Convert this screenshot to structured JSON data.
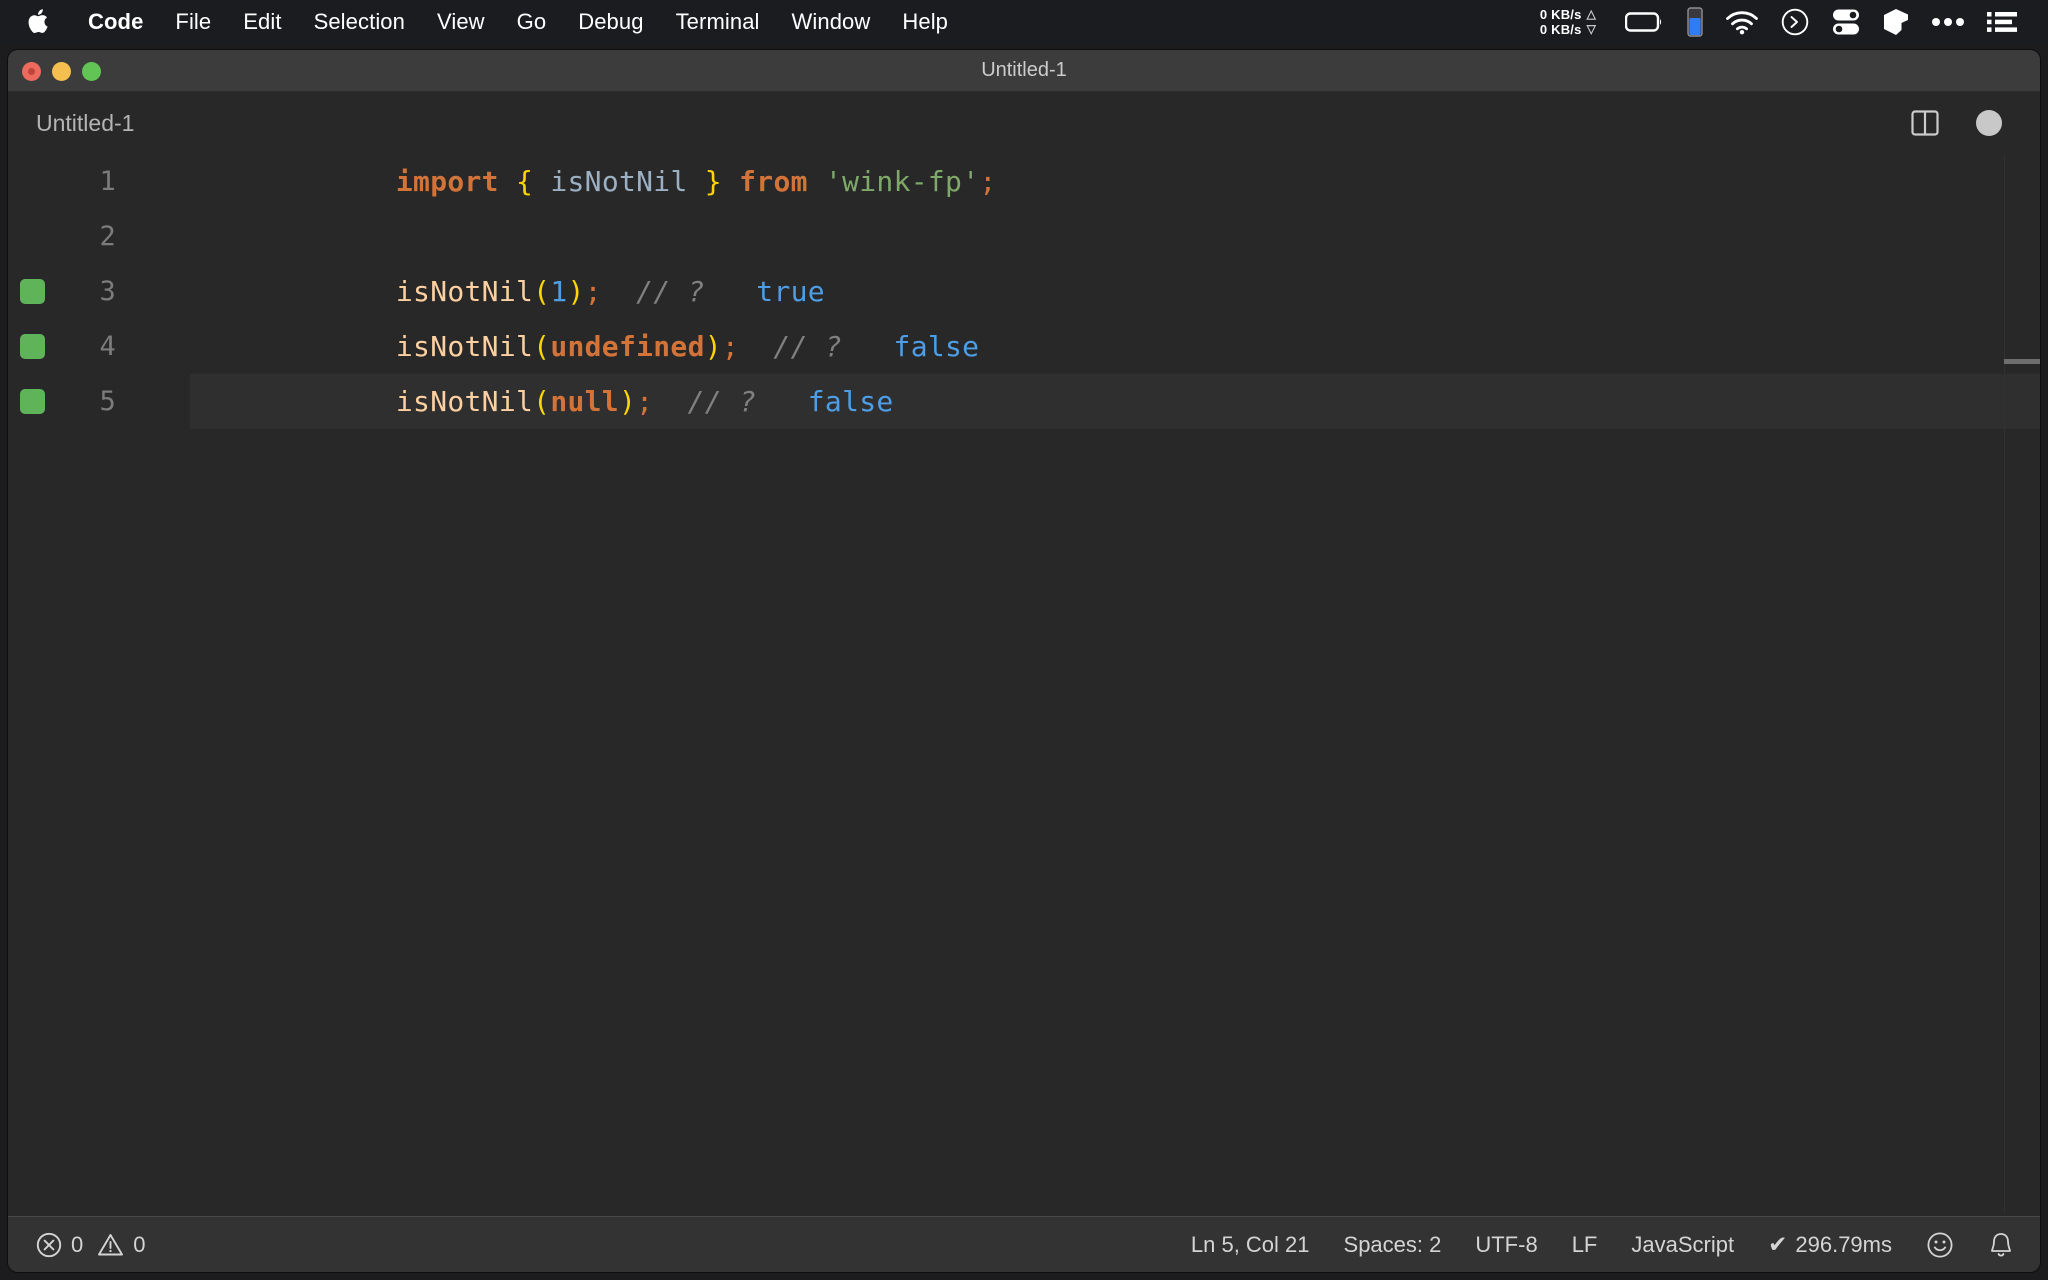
{
  "menubar": {
    "apple_icon": "apple-logo-icon",
    "items": [
      {
        "label": "Code",
        "bold": true
      },
      {
        "label": "File",
        "bold": false
      },
      {
        "label": "Edit",
        "bold": false
      },
      {
        "label": "Selection",
        "bold": false
      },
      {
        "label": "View",
        "bold": false
      },
      {
        "label": "Go",
        "bold": false
      },
      {
        "label": "Debug",
        "bold": false
      },
      {
        "label": "Terminal",
        "bold": false
      },
      {
        "label": "Window",
        "bold": false
      },
      {
        "label": "Help",
        "bold": false
      }
    ],
    "network": {
      "upload": "0 KB/s",
      "download": "0 KB/s",
      "up_arrow": "△",
      "down_arrow": "▽"
    },
    "status_icons": [
      "battery-icon",
      "device-battery-blue-icon",
      "wifi-icon",
      "terminal-prompt-icon",
      "control-center-icon",
      "docker-box-icon",
      "ellipsis-icon",
      "menu-list-icon"
    ]
  },
  "window": {
    "title": "Untitled-1",
    "traffic_lights": [
      "close-button",
      "minimize-button",
      "zoom-button"
    ]
  },
  "editor": {
    "tab": {
      "label": "Untitled-1"
    },
    "actions": [
      "split-editor-icon",
      "unsaved-dot-indicator"
    ],
    "lines": [
      {
        "number": "1",
        "marker": false,
        "active": false,
        "tokens": [
          {
            "text": "import",
            "cls": "t-kw"
          },
          {
            "text": " ",
            "cls": "t-plain"
          },
          {
            "text": "{",
            "cls": "t-brc"
          },
          {
            "text": " ",
            "cls": "t-plain"
          },
          {
            "text": "isNotNil",
            "cls": "t-ident"
          },
          {
            "text": " ",
            "cls": "t-plain"
          },
          {
            "text": "}",
            "cls": "t-brc"
          },
          {
            "text": " ",
            "cls": "t-plain"
          },
          {
            "text": "from",
            "cls": "t-kw"
          },
          {
            "text": " ",
            "cls": "t-plain"
          },
          {
            "text": "'wink-fp'",
            "cls": "t-str"
          },
          {
            "text": ";",
            "cls": "t-punc"
          }
        ]
      },
      {
        "number": "2",
        "marker": false,
        "active": false,
        "tokens": []
      },
      {
        "number": "3",
        "marker": true,
        "active": false,
        "tokens": [
          {
            "text": "isNotNil",
            "cls": "t-fn"
          },
          {
            "text": "(",
            "cls": "t-brc"
          },
          {
            "text": "1",
            "cls": "t-num"
          },
          {
            "text": ")",
            "cls": "t-brc"
          },
          {
            "text": ";",
            "cls": "t-punc"
          },
          {
            "text": " ",
            "cls": "t-plain"
          },
          {
            "text": "// ?",
            "cls": "t-com"
          },
          {
            "text": "  ",
            "cls": "t-plain"
          },
          {
            "text": "true",
            "cls": "t-bool"
          }
        ]
      },
      {
        "number": "4",
        "marker": true,
        "active": false,
        "tokens": [
          {
            "text": "isNotNil",
            "cls": "t-fn"
          },
          {
            "text": "(",
            "cls": "t-brc"
          },
          {
            "text": "undefined",
            "cls": "t-kwval"
          },
          {
            "text": ")",
            "cls": "t-brc"
          },
          {
            "text": ";",
            "cls": "t-punc"
          },
          {
            "text": " ",
            "cls": "t-plain"
          },
          {
            "text": "// ?",
            "cls": "t-com"
          },
          {
            "text": "  ",
            "cls": "t-plain"
          },
          {
            "text": "false",
            "cls": "t-bool"
          }
        ]
      },
      {
        "number": "5",
        "marker": true,
        "active": true,
        "tokens": [
          {
            "text": "isNotNil",
            "cls": "t-fn"
          },
          {
            "text": "(",
            "cls": "t-brc"
          },
          {
            "text": "null",
            "cls": "t-kwval"
          },
          {
            "text": ")",
            "cls": "t-brc"
          },
          {
            "text": ";",
            "cls": "t-punc"
          },
          {
            "text": " ",
            "cls": "t-plain"
          },
          {
            "text": "// ?",
            "cls": "t-com"
          },
          {
            "text": "  ",
            "cls": "t-plain"
          },
          {
            "text": "false",
            "cls": "t-bool"
          }
        ]
      }
    ],
    "marker_color": "#5fb45a"
  },
  "statusbar": {
    "errors": "0",
    "warnings": "0",
    "error_icon": "error-circle-icon",
    "warning_icon": "warning-triangle-icon",
    "cursor_position": "Ln 5, Col 21",
    "indentation": "Spaces: 2",
    "encoding": "UTF-8",
    "eol": "LF",
    "language": "JavaScript",
    "check_glyph": "✔",
    "run_time": "296.79ms",
    "feedback_icon": "smiley-icon",
    "notifications_icon": "bell-icon"
  }
}
